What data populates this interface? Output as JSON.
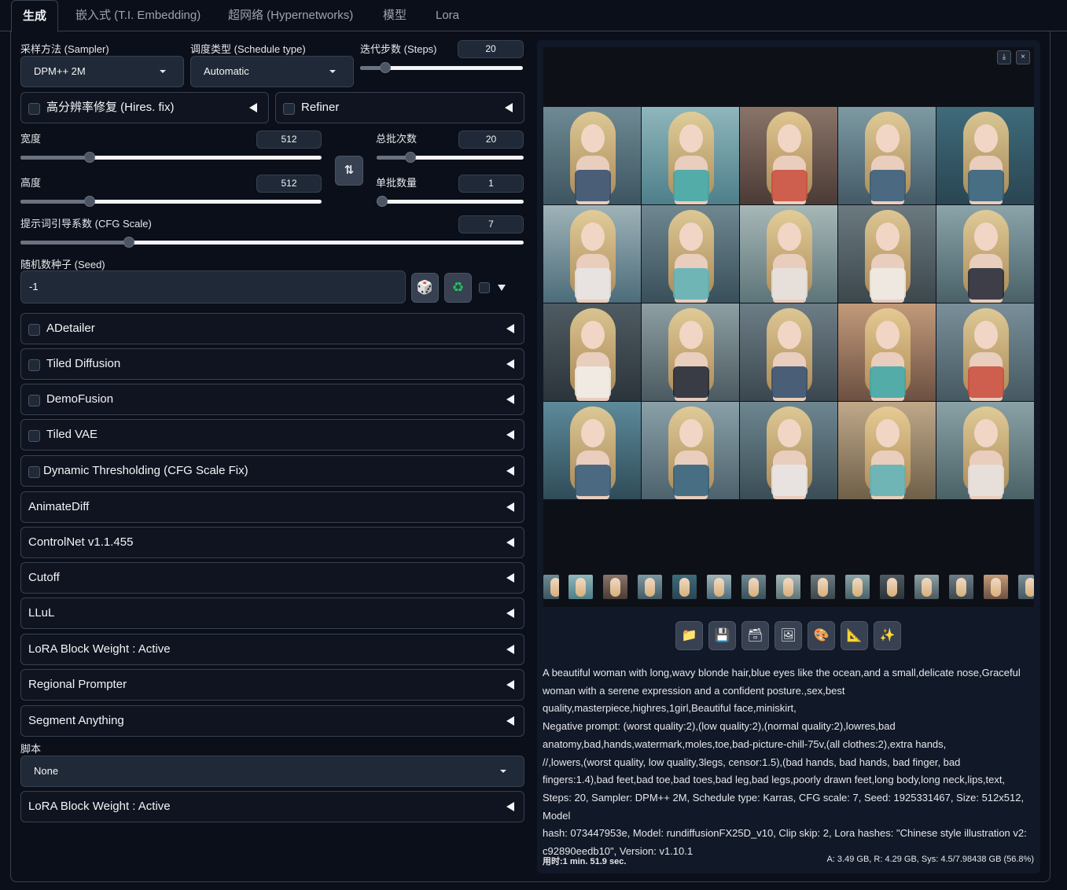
{
  "tabs": [
    "生成",
    "嵌入式 (T.I. Embedding)",
    "超网络 (Hypernetworks)",
    "模型",
    "Lora"
  ],
  "sampler": {
    "label": "采样方法 (Sampler)",
    "value": "DPM++ 2M"
  },
  "schedule": {
    "label": "调度类型 (Schedule type)",
    "value": "Automatic"
  },
  "steps": {
    "label": "迭代步数 (Steps)",
    "value": "20",
    "fraction": 0.13
  },
  "hires": {
    "label": "高分辨率修复 (Hires. fix)"
  },
  "refiner": {
    "label": "Refiner"
  },
  "width": {
    "label": "宽度",
    "value": "512",
    "fraction": 0.22
  },
  "height": {
    "label": "高度",
    "value": "512",
    "fraction": 0.22
  },
  "batch_count": {
    "label": "总批次数",
    "value": "20",
    "fraction": 0.21
  },
  "batch_size": {
    "label": "单批数量",
    "value": "1",
    "fraction": 0.0
  },
  "cfg": {
    "label": "提示词引导系数 (CFG Scale)",
    "value": "7",
    "fraction": 0.21
  },
  "seed": {
    "label": "随机数种子 (Seed)",
    "value": "-1"
  },
  "icons": {
    "swap": "swap-icon",
    "dice": "dice-icon",
    "recycle": "recycle-icon"
  },
  "accordions": [
    "ADetailer",
    "Tiled Diffusion",
    "DemoFusion",
    "Tiled VAE",
    "Dynamic Thresholding (CFG Scale Fix)",
    "AnimateDiff",
    "ControlNet v1.1.455",
    "Cutoff",
    "LLuL",
    "LoRA Block Weight : Active",
    "Regional Prompter",
    "Segment Anything"
  ],
  "script": {
    "label": "脚本",
    "value": "None"
  },
  "bottom_accordion": "LoRA Block Weight : Active",
  "gallery": {
    "download_icon": "⤓",
    "close_icon": "×"
  },
  "toolbar_icons": [
    "folder-icon",
    "save-icon",
    "zip-icon",
    "image-icon",
    "palette-icon",
    "ruler-icon",
    "sparkle-icon"
  ],
  "info_lines": [
    "A beautiful woman with long,wavy blonde hair,blue eyes like the ocean,and a small,delicate nose,Graceful",
    "woman with a serene expression and a confident posture.,sex,best",
    "quality,masterpiece,highres,1girl,Beautiful face,miniskirt,",
    "Negative prompt: (worst quality:2),(low quality:2),(normal quality:2),lowres,bad",
    "anatomy,bad,hands,watermark,moles,toe,bad-picture-chill-75v,(all clothes:2),extra hands,",
    "//,lowers,(worst quality, low quality,3legs, censor:1.5),(bad hands, bad hands, bad finger, bad",
    "fingers:1.4),bad feet,bad toe,bad toes,bad leg,bad legs,poorly drawn feet,long body,long neck,lips,text,",
    "Steps: 20, Sampler: DPM++ 2M, Schedule type: Karras, CFG scale: 7, Seed: 1925331467, Size: 512x512, Model",
    "hash: 073447953e, Model: rundiffusionFX25D_v10, Clip skip: 2, Lora hashes: \"Chinese style illustration v2:",
    "c92890eedb10\", Version: v1.10.1"
  ],
  "time_text": "用时:1 min. 51.9 sec.",
  "mem_text": "A: 3.49 GB, R: 4.29 GB, Sys: 4.5/7.98438 GB (56.8%)"
}
